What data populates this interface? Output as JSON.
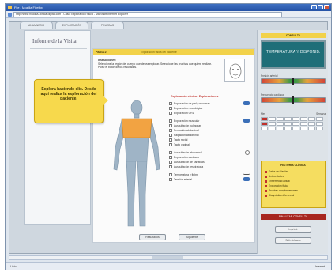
{
  "window": {
    "title": "File - Mozilla Firefox",
    "address": "http://www.historia-clinica-digital.com - Caso: Exploración física - Microsoft Internet Explorer"
  },
  "tabs": [
    {
      "label": "Anamnesis"
    },
    {
      "label": "Exploración"
    },
    {
      "label": "Pruebas"
    }
  ],
  "left": {
    "heading": "Informe de la Visita"
  },
  "tooltip": {
    "text": "Explora haciendo clic. Desde aquí realiza la exploración del paciente."
  },
  "center": {
    "step": "PASO 2",
    "info": "Exploración física del paciente",
    "inst_title": "Instrucciones:",
    "inst_text": "Seleccione la región del cuerpo que desea explorar. Seleccione las pruebas que quiere realizar. Pulse el botón de los resultados.",
    "exam_title": "Exploración clínica / Exploraciones",
    "groups": [
      [
        {
          "label": "Exploración de piel y mucosas",
          "icon": "blue"
        },
        {
          "label": "Exploración neurológica",
          "icon": "none"
        },
        {
          "label": "Exploración ORL",
          "icon": "none"
        }
      ],
      [
        {
          "label": "Exploración muscular",
          "icon": "hand"
        },
        {
          "label": "Auscultación pulmonar",
          "icon": "none"
        },
        {
          "label": "Percusión abdominal",
          "icon": "none"
        },
        {
          "label": "Palpación abdominal",
          "icon": "none"
        },
        {
          "label": "Tacto rectal",
          "icon": "none"
        },
        {
          "label": "Tacto vaginal",
          "icon": "none"
        }
      ],
      [
        {
          "label": "Auscultación abdominal",
          "icon": "round"
        },
        {
          "label": "Exploración cardíaca",
          "icon": "none"
        },
        {
          "label": "Auscultación de carótidas",
          "icon": "none"
        },
        {
          "label": "Auscultación respiratoria",
          "icon": "none"
        }
      ],
      [
        {
          "label": "Temperatura y fiebre",
          "icon": "line"
        },
        {
          "label": "Tensión arterial",
          "icon": "blue"
        }
      ]
    ],
    "buttons": {
      "left": "Resultados",
      "right": "Siguiente"
    }
  },
  "right": {
    "top_label": "CONSULTA",
    "display_text": "TEMPERATURA Y DISPONIB.",
    "vital1": {
      "label": "Presión arterial",
      "level": 0.5
    },
    "vital2": {
      "label": "Frecuencia cardíaca",
      "level": 0.5
    },
    "cal_head_left": "Mes",
    "cal_head_right": "Semana",
    "notes": {
      "title": "HISTORIA CLÍNICA",
      "items": [
        "Datos de filiación",
        "Antecedentes",
        "Enfermedad actual",
        "Exploración física",
        "Pruebas complementarias",
        "Diagnóstico diferencial"
      ]
    },
    "red_button": "FINALIZAR CONSULTA",
    "gbtn1": "Imprimir",
    "gbtn2": "Salir del caso"
  },
  "status": {
    "left": "Listo",
    "right": "Internet"
  }
}
